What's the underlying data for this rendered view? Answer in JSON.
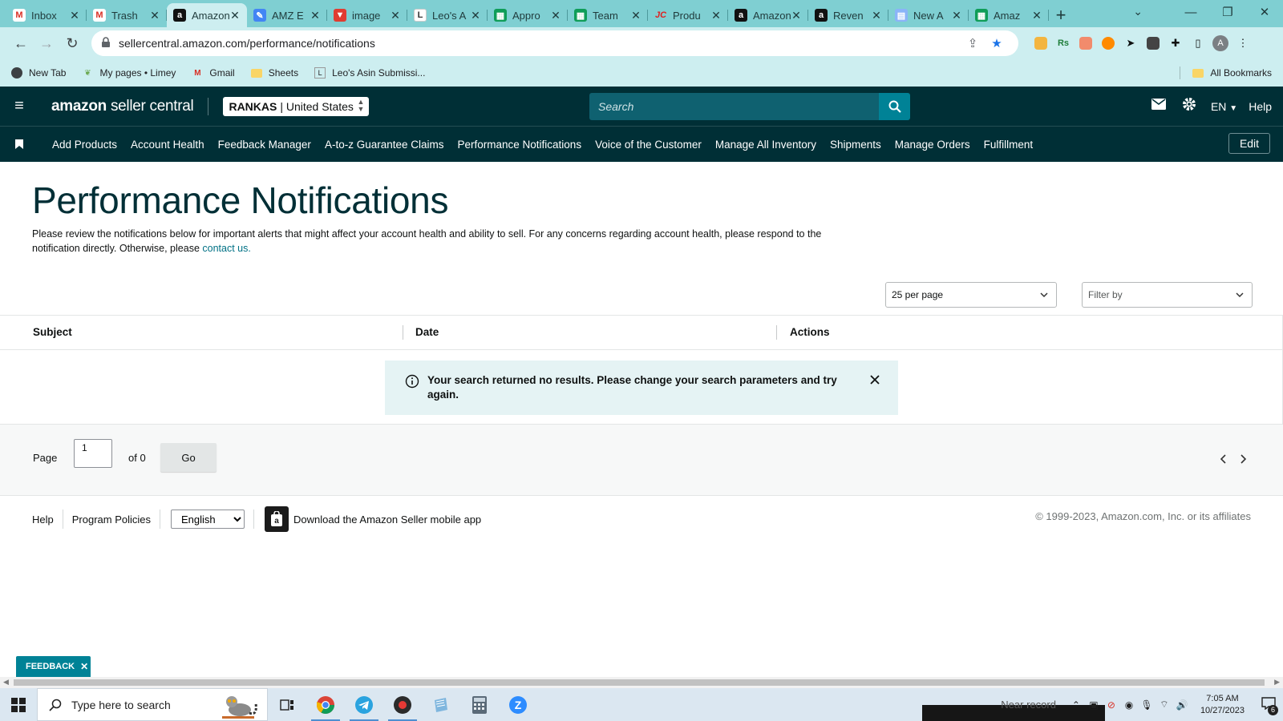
{
  "browser": {
    "tabs": [
      {
        "title": "Inbox",
        "icon": "gmail-icon",
        "color": "#d93025",
        "glyph": "M"
      },
      {
        "title": "Trash",
        "icon": "gmail-icon",
        "color": "#d93025",
        "glyph": "M"
      },
      {
        "title": "Amazon",
        "icon": "amazon-icon",
        "color": "#111111",
        "glyph": "a",
        "active": true
      },
      {
        "title": "AMZ E",
        "icon": "pencil-icon",
        "color": "#4285f4",
        "glyph": "✎"
      },
      {
        "title": "image",
        "icon": "vivaldi-icon",
        "color": "#e03c31",
        "glyph": "▼"
      },
      {
        "title": "Leo's A",
        "icon": "leo-icon",
        "color": "#ffffff",
        "glyph": "L"
      },
      {
        "title": "Appro",
        "icon": "sheets-icon",
        "color": "#0f9d58",
        "glyph": "▦"
      },
      {
        "title": "Team",
        "icon": "sheets-icon",
        "color": "#0f9d58",
        "glyph": "▦"
      },
      {
        "title": "Produ",
        "icon": "jc-icon",
        "color": "#e02020",
        "glyph": "JC"
      },
      {
        "title": "Amazon",
        "icon": "amazon-icon",
        "color": "#111111",
        "glyph": "a"
      },
      {
        "title": "Reven",
        "icon": "amazon-icon",
        "color": "#111111",
        "glyph": "a"
      },
      {
        "title": "New A",
        "icon": "doc-icon",
        "color": "#8ab4f8",
        "glyph": "▤"
      },
      {
        "title": "Amaz",
        "icon": "sheets-icon",
        "color": "#0f9d58",
        "glyph": "▦"
      }
    ],
    "url": "sellercentral.amazon.com/performance/notifications",
    "bookmarks": [
      {
        "label": "New Tab",
        "icon": "chrome-icon"
      },
      {
        "label": "My pages • Limey",
        "icon": "leaf-icon"
      },
      {
        "label": "Gmail",
        "icon": "gmail-icon"
      },
      {
        "label": "Sheets",
        "icon": "folder-icon"
      },
      {
        "label": "Leo's Asin Submissi...",
        "icon": "leo-icon"
      }
    ],
    "all_bookmarks": "All Bookmarks",
    "profile_initial": "A"
  },
  "header": {
    "logo_amazon": "amazon",
    "logo_seller": "seller central",
    "account_name": "RANKAS",
    "account_region": "| United States",
    "search_placeholder": "Search",
    "language": "EN",
    "help": "Help"
  },
  "nav": {
    "items": [
      "Add Products",
      "Account Health",
      "Feedback Manager",
      "A-to-z Guarantee Claims",
      "Performance Notifications",
      "Voice of the Customer",
      "Manage All Inventory",
      "Shipments",
      "Manage Orders",
      "Fulfillment"
    ],
    "edit": "Edit"
  },
  "main": {
    "title": "Performance Notifications",
    "description": "Please review the notifications below for important alerts that might affect your account health and ability to sell. For any concerns regarding account health, please respond to the notification directly. Otherwise, please ",
    "contact_link": "contact us.",
    "per_page": "25 per page",
    "filter_by": "Filter by",
    "columns": [
      "Subject",
      "Date",
      "Actions"
    ],
    "empty_message": "Your search returned no results. Please change your search parameters and try again.",
    "pager": {
      "page_label": "Page",
      "page_value": "1",
      "of_label": "of 0",
      "go": "Go"
    }
  },
  "footer": {
    "help": "Help",
    "policies": "Program Policies",
    "language": "English",
    "app_text": "Download the Amazon Seller mobile app",
    "copyright": "© 1999-2023, Amazon.com, Inc. or its affiliates"
  },
  "feedback": "FEEDBACK",
  "taskbar": {
    "search_placeholder": "Type here to search",
    "near_record": "Near record",
    "time": "7:05 AM",
    "date": "10/27/2023",
    "notification_count": "6"
  },
  "colors": {
    "header_bg": "#002f36",
    "accent_teal": "#008296",
    "link": "#007185",
    "chrome_tab_bg": "#7fcfd2",
    "chrome_toolbar": "#cdeef0",
    "alert_bg": "#e5f3f4"
  }
}
